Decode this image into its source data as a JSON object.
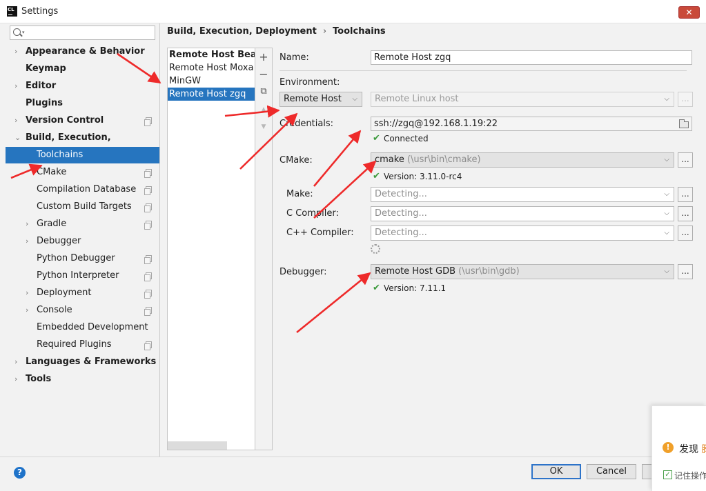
{
  "window": {
    "title": "Settings",
    "app_icon": "CL",
    "close_glyph": "✕"
  },
  "search": {
    "value": "",
    "placeholder": ""
  },
  "sidebar": {
    "items": [
      {
        "label": "Appearance & Behavior",
        "bold": true,
        "arrow": "›",
        "indent": 0
      },
      {
        "label": "Keymap",
        "bold": true,
        "indent": 0
      },
      {
        "label": "Editor",
        "bold": true,
        "arrow": "›",
        "indent": 0
      },
      {
        "label": "Plugins",
        "bold": true,
        "indent": 0
      },
      {
        "label": "Version Control",
        "bold": true,
        "arrow": "›",
        "indent": 0,
        "copy_icon": true
      },
      {
        "label": "Build, Execution, Deployment",
        "bold": true,
        "arrow": "⌄",
        "indent": 0
      },
      {
        "label": "Toolchains",
        "indent": 1,
        "selected": true
      },
      {
        "label": "CMake",
        "indent": 1,
        "copy_icon": true
      },
      {
        "label": "Compilation Database",
        "indent": 1,
        "copy_icon": true
      },
      {
        "label": "Custom Build Targets",
        "indent": 1,
        "copy_icon": true
      },
      {
        "label": "Gradle",
        "indent": 1,
        "arrow": "›",
        "copy_icon": true
      },
      {
        "label": "Debugger",
        "indent": 1,
        "arrow": "›"
      },
      {
        "label": "Python Debugger",
        "indent": 1,
        "copy_icon": true
      },
      {
        "label": "Python Interpreter",
        "indent": 1,
        "copy_icon": true
      },
      {
        "label": "Deployment",
        "indent": 1,
        "arrow": "›",
        "copy_icon": true
      },
      {
        "label": "Console",
        "indent": 1,
        "arrow": "›",
        "copy_icon": true
      },
      {
        "label": "Embedded Development",
        "indent": 1
      },
      {
        "label": "Required Plugins",
        "indent": 1,
        "copy_icon": true
      },
      {
        "label": "Languages & Frameworks",
        "bold": true,
        "arrow": "›",
        "indent": 0
      },
      {
        "label": "Tools",
        "bold": true,
        "arrow": "›",
        "indent": 0
      }
    ]
  },
  "breadcrumb": {
    "parent": "Build, Execution, Deployment",
    "separator": "›",
    "current": "Toolchains"
  },
  "toolchains": [
    {
      "label": "Remote Host Beagle",
      "bold": true
    },
    {
      "label": "Remote Host Moxa"
    },
    {
      "label": "MinGW"
    },
    {
      "label": "Remote Host zgq",
      "selected": true
    }
  ],
  "toolbar": {
    "add": "+",
    "remove": "−",
    "copy": "⧉",
    "up": "▲",
    "down": "▼"
  },
  "form": {
    "name_label": "Name:",
    "name_value": "Remote Host zgq",
    "environment_label": "Environment:",
    "environment_value": "Remote Host",
    "environment_host_placeholder": "Remote Linux host",
    "credentials_label": "Credentials:",
    "credentials_value": "ssh://zgq@192.168.1.19:22",
    "credentials_status": "Connected",
    "cmake_label": "CMake:",
    "cmake_value": "cmake",
    "cmake_path": "(\\usr\\bin\\cmake)",
    "cmake_version": "Version: 3.11.0-rc4",
    "make_label": "Make:",
    "make_value": "Detecting...",
    "c_compiler_label": "C Compiler:",
    "c_compiler_value": "Detecting...",
    "cpp_compiler_label": "C++ Compiler:",
    "cpp_compiler_value": "Detecting...",
    "debugger_label": "Debugger:",
    "debugger_value": "Remote Host GDB",
    "debugger_path": "(\\usr\\bin\\gdb)",
    "debugger_version": "Version: 7.11.1",
    "ellipsis": "...",
    "check_glyph": "✔",
    "chevron": "⌵"
  },
  "footer": {
    "help": "?",
    "ok": "OK",
    "cancel": "Cancel"
  },
  "popup": {
    "warn_glyph": "!",
    "text": "发现",
    "text_accent": "腾",
    "checkbox_label": "记住操作"
  },
  "colors": {
    "selection": "#2675bf",
    "annotation_arrow": "#ee2a2a",
    "check_green": "#3c9a3c",
    "close_red": "#c94a3a"
  }
}
